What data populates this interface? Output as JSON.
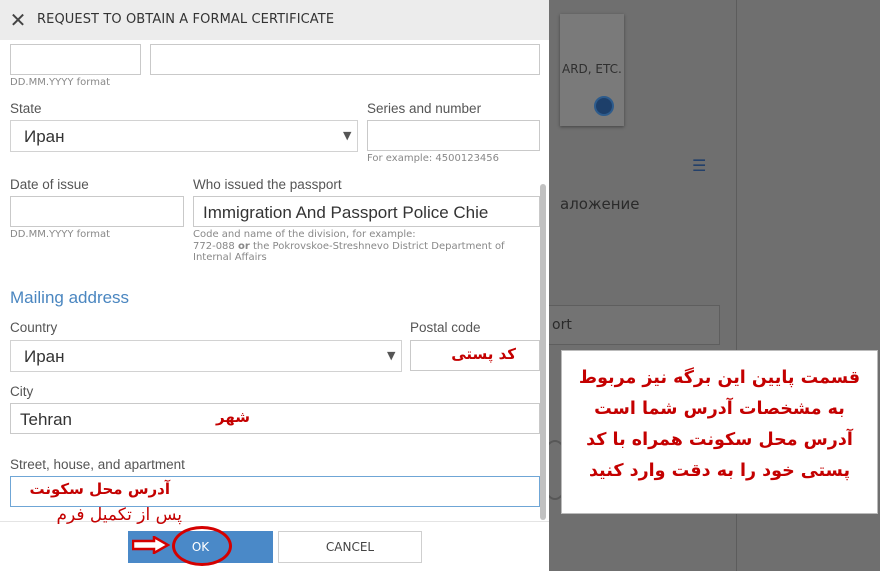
{
  "dialog": {
    "title": "REQUEST TO OBTAIN A FORMAL CERTIFICATE",
    "top_hint": "DD.MM.YYYY format",
    "state": {
      "label": "State",
      "value": "Иран"
    },
    "series": {
      "label": "Series and number",
      "value": "",
      "hint": "For example: 4500123456"
    },
    "date_of_issue": {
      "label": "Date of issue",
      "value": "",
      "hint": "DD.MM.YYYY format"
    },
    "issued_by": {
      "label": "Who issued the passport",
      "value": "Immigration And Passport Police Chie",
      "hint_line1": "Code and name of the division, for example:",
      "hint_line2_a": "772-088 ",
      "hint_line2_or": "or",
      "hint_line2_b": " the Pokrovskoe-Streshnevo District Department of",
      "hint_line3": "Internal Affairs"
    },
    "mailing_section": "Mailing address",
    "country": {
      "label": "Country",
      "value": "Иран"
    },
    "postal_code": {
      "label": "Postal code",
      "value": ""
    },
    "city": {
      "label": "City",
      "value": "Tehran"
    },
    "street": {
      "label": "Street, house, and apartment",
      "value": ""
    },
    "ok_label": "OK",
    "cancel_label": "CANCEL"
  },
  "annotations": {
    "postal": "کد پستی",
    "city": "شهر",
    "street": "آدرس محل سکونت",
    "after_form": "پس از تکمیل فرم",
    "callout_lines": [
      "قسمت پایین این برگه نیز مربوط",
      "به مشخصات آدرس شما است",
      "آدرس محل سکونت همراه با کد",
      "پستی خود را به دقت وارد کنید"
    ]
  },
  "background": {
    "card_text": "ARD, ETC.",
    "text1": "аложение",
    "field_text": "ort"
  },
  "colors": {
    "accent": "#4a89c8",
    "section": "#4a86c0",
    "annotation": "#c40000"
  }
}
